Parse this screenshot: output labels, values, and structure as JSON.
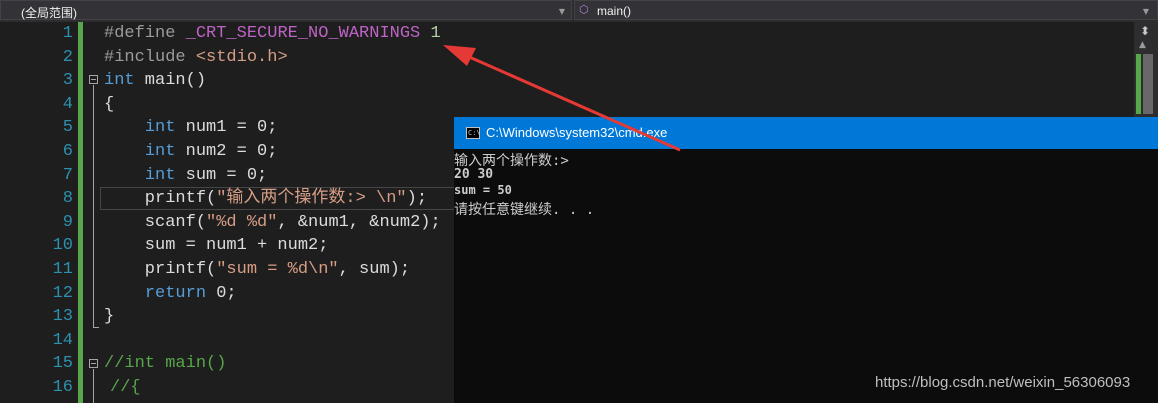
{
  "navbar": {
    "scope": "(全局范围)",
    "function": "main()"
  },
  "gutter": {
    "line_numbers": [
      "1",
      "2",
      "3",
      "4",
      "5",
      "6",
      "7",
      "8",
      "9",
      "10",
      "11",
      "12",
      "13",
      "14",
      "15",
      "16"
    ]
  },
  "code": {
    "l1": {
      "a": "#define ",
      "b": "_CRT_SECURE_NO_WARNINGS",
      "c": " 1"
    },
    "l2": {
      "a": "#include ",
      "b": "<stdio.h>"
    },
    "l3": {
      "a": "int",
      "b": " main()"
    },
    "l4": {
      "a": "{"
    },
    "l5": {
      "a": "    ",
      "b": "int",
      "c": " num1 = 0;"
    },
    "l6": {
      "a": "    ",
      "b": "int",
      "c": " num2 = 0;"
    },
    "l7": {
      "a": "    ",
      "b": "int",
      "c": " sum = 0;"
    },
    "l8": {
      "a": "    printf(",
      "b": "\"输入两个操作数:> \\n\"",
      "c": ");"
    },
    "l9": {
      "a": "    scanf(",
      "b": "\"%d %d\"",
      "c": ", &num1, &num2);"
    },
    "l10": {
      "a": "    sum = num1 + num2;"
    },
    "l11": {
      "a": "    printf(",
      "b": "\"sum = %d\\n\"",
      "c": ", sum);"
    },
    "l12": {
      "a": "    ",
      "b": "return",
      "c": " 0;"
    },
    "l13": {
      "a": "}"
    },
    "l14": {
      "a": ""
    },
    "l15": {
      "a": "//int main()"
    },
    "l16": {
      "a": "//{"
    }
  },
  "console": {
    "title": "C:\\Windows\\system32\\cmd.exe",
    "lines": [
      "输入两个操作数:>",
      "20 30",
      "sum = 50",
      "请按任意键继续. . ."
    ]
  },
  "watermark": "https://blog.csdn.net/weixin_56306093",
  "colors": {
    "arrow": "#e53935",
    "title_bar": "#0078d7",
    "line_numbers": "#2b91af"
  },
  "icons": [
    "chevron-down-icon",
    "function-cube-icon",
    "split-view-icon",
    "console-icon",
    "arrow-annotation"
  ]
}
